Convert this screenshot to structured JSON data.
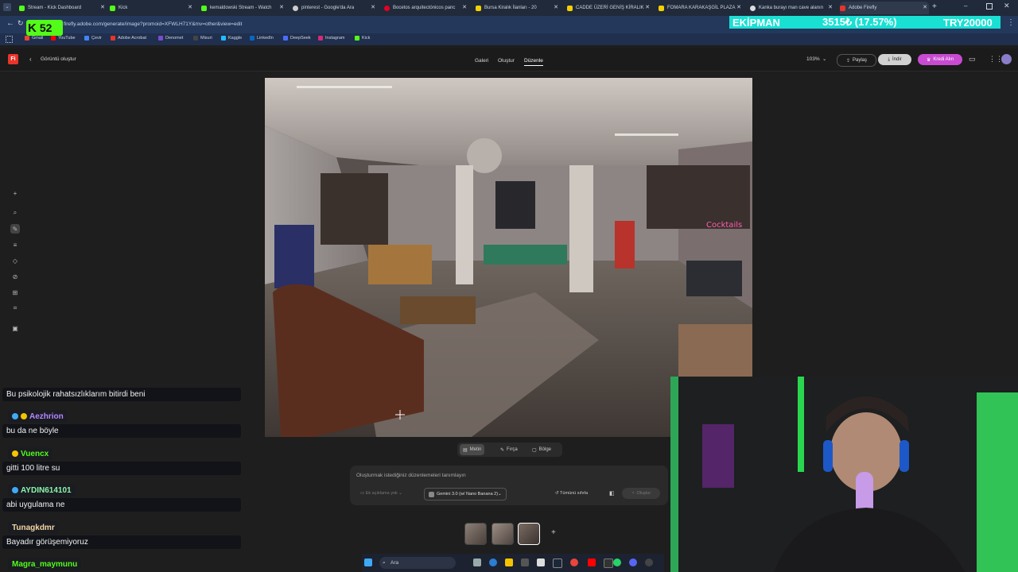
{
  "browser": {
    "tabs": [
      {
        "label": "Stream - Kick Dashboard",
        "color": "#53fc18"
      },
      {
        "label": "Kick",
        "color": "#53fc18"
      },
      {
        "label": "kemaldowski Stream - Watch",
        "color": "#53fc18"
      },
      {
        "label": "pinterest - Google'da Ara",
        "color": "#cccccc"
      },
      {
        "label": "Bocetos arquitectónicos panc",
        "color": "#e60023"
      },
      {
        "label": "Bursa Kiralık İlanları - 20",
        "color": "#f5d000"
      },
      {
        "label": "CADDE ÜZERİ GENİŞ KİRALIK",
        "color": "#f5d000"
      },
      {
        "label": "FOMARA KARAKAŞGİL PLAZA",
        "color": "#f5d000"
      },
      {
        "label": "Kanka burayı man cave alanın",
        "color": "#dddddd"
      },
      {
        "label": "Adobe Firefly",
        "color": "#e8342a"
      }
    ],
    "url": "firefly.adobe.com/generate/image?promoid=XFWLH71Y&mv=other&view=edit",
    "bookmarks": [
      "Gmail",
      "YouTube",
      "Çevir",
      "Adobe Acrobat",
      "Denomet",
      "Misuri",
      "Kaggle",
      "LinkedIn",
      "DeepSeek",
      "Instagram",
      "Kick"
    ]
  },
  "overlay": {
    "kick_logo": "K",
    "kick_count": "52",
    "ticker_label": "EKİPMAN",
    "ticker_value": "3515₺ (17.57%)",
    "ticker_goal": "TRY20000"
  },
  "firefly": {
    "logo": "Fi",
    "back_label": "Görüntü oluştur",
    "nav": [
      "Galeri",
      "Oluştur",
      "Düzenle"
    ],
    "zoom": "103%",
    "share_label": "Paylaş",
    "download_label": "İndir",
    "credits_label": "Kredi Alın",
    "modes": [
      "Metin",
      "Fırça",
      "Bölge"
    ],
    "prompt_placeholder": "Oluşturmak istediğiniz düzenlemeleri tanımlayın",
    "ref_label": "Ek açıklama yok",
    "model_label": "Gemini 3.0 (w/ Nano Banana 2)",
    "clear_label": "Tümünü sıfırla",
    "generate_label": "Oluştur"
  },
  "chat": [
    {
      "type": "msg",
      "text": "Bu psikolojik rahatsızlıklarım bitirdi beni"
    },
    {
      "type": "name",
      "text": "Aezhrion",
      "color": "#b388ff"
    },
    {
      "type": "msg",
      "text": "bu da ne böyle"
    },
    {
      "type": "name",
      "text": "Vuencx",
      "color": "#53fc18"
    },
    {
      "type": "msg",
      "text": "gitti 100 litre su"
    },
    {
      "type": "name",
      "text": "AYDIN614101",
      "color": "#8cf5a8"
    },
    {
      "type": "msg",
      "text": "abi uygulama ne"
    },
    {
      "type": "name",
      "text": "Tunagkdmr",
      "color": "#f5d7a0"
    },
    {
      "type": "msg",
      "text": "Bayadır görüşemiyoruz"
    },
    {
      "type": "name",
      "text": "Magra_maymunu",
      "color": "#53fc18"
    }
  ],
  "taskbar": {
    "search_label": "Ara"
  }
}
